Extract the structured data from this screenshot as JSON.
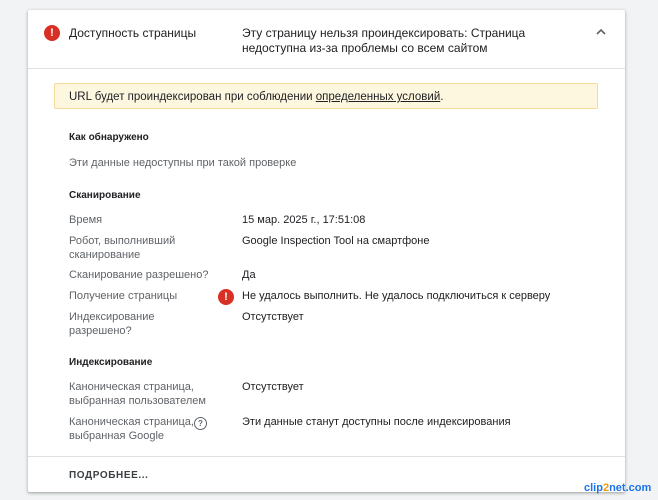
{
  "header": {
    "title": "Доступность страницы",
    "description": "Эту страницу нельзя проиндексировать: Страница недоступна из-за проблемы со всем сайтом",
    "status_icon": "error-icon",
    "toggle_icon": "chevron-up-icon"
  },
  "notice": {
    "prefix": "URL будет проиндексирован при соблюдении ",
    "link": "определенных условий",
    "suffix": "."
  },
  "discovery": {
    "title": "Как обнаружено",
    "message": "Эти данные недоступны при такой проверке"
  },
  "crawl": {
    "title": "Сканирование",
    "rows": [
      {
        "label": "Время",
        "value": "15 мар. 2025 г., 17:51:08"
      },
      {
        "label": "Робот, выполнивший сканирование",
        "value": "Google Inspection Tool на смартфоне"
      },
      {
        "label": "Сканирование разрешено?",
        "value": "Да"
      },
      {
        "label": "Получение страницы",
        "value": "Не удалось выполнить. Не удалось подключиться к серверу",
        "icon": "error-icon"
      },
      {
        "label": "Индексирование разрешено?",
        "value": "Отсутствует"
      }
    ]
  },
  "indexing": {
    "title": "Индексирование",
    "rows": [
      {
        "label": "Каноническая страница, выбранная пользователем",
        "value": "Отсутствует"
      },
      {
        "label": "Каноническая страница, выбранная Google",
        "value": "Эти данные станут доступны после индексирования",
        "icon": "help-icon"
      }
    ]
  },
  "footer": {
    "more_label": "ПОДРОБНЕЕ..."
  },
  "watermark": {
    "part1": "clip",
    "part2": "2",
    "part3": "net.com"
  },
  "colors": {
    "error": "#d93025",
    "notice_bg": "#fef7e0",
    "notice_border": "#f6dd96"
  }
}
